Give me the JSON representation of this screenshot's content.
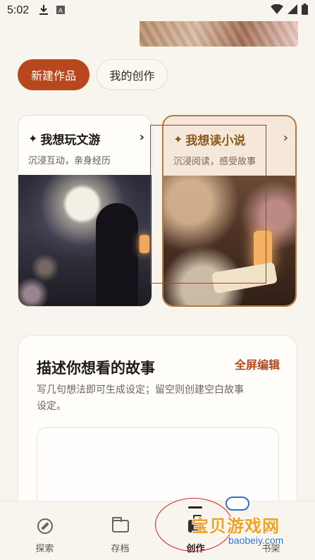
{
  "status_bar": {
    "time": "5:02",
    "icons": [
      "download-icon",
      "app-icon",
      "wifi-icon",
      "signal-icon",
      "battery-icon"
    ]
  },
  "tabs": [
    {
      "label": "新建作品",
      "active": true
    },
    {
      "label": "我的创作",
      "active": false
    }
  ],
  "cards": [
    {
      "title": "我想玩文游",
      "subtitle": "沉浸互动，亲身经历",
      "icon": "sparkle-icon",
      "selected": false
    },
    {
      "title": "我想读小说",
      "subtitle": "沉浸阅读，感受故事",
      "icon": "sparkle-icon",
      "selected": true
    }
  ],
  "panel": {
    "title": "描述你想看的故事",
    "action": "全屏编辑",
    "hint": "写几句想法即可生成设定；留空则创建空白故事设定。",
    "input_value": ""
  },
  "bottom_nav": [
    {
      "label": "探索",
      "icon": "compass-icon",
      "active": false
    },
    {
      "label": "存档",
      "icon": "folder-icon",
      "active": false
    },
    {
      "label": "创作",
      "icon": "briefcase-icon",
      "active": true
    },
    {
      "label": "书架",
      "icon": "book-icon",
      "active": false
    }
  ],
  "watermark": {
    "text": "宝贝游戏网",
    "url": "baobeiy.com"
  },
  "colors": {
    "accent": "#b9471d",
    "background": "#f8f4ee",
    "selected_card_border": "#b07d3f",
    "annotation": "#d3242a"
  }
}
